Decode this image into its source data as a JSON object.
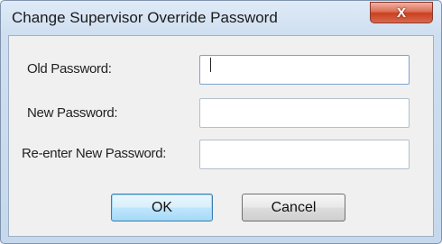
{
  "dialog": {
    "title": "Change Supervisor Override Password",
    "close_glyph": "X"
  },
  "fields": {
    "old_password": {
      "label": "Old Password:",
      "value": ""
    },
    "new_password": {
      "label": "New Password:",
      "value": ""
    },
    "reenter_password": {
      "label": "Re-enter New Password:",
      "value": ""
    }
  },
  "buttons": {
    "ok": "OK",
    "cancel": "Cancel"
  },
  "colors": {
    "close_button": "#d0553a",
    "default_button_border": "#3c7fb1"
  }
}
